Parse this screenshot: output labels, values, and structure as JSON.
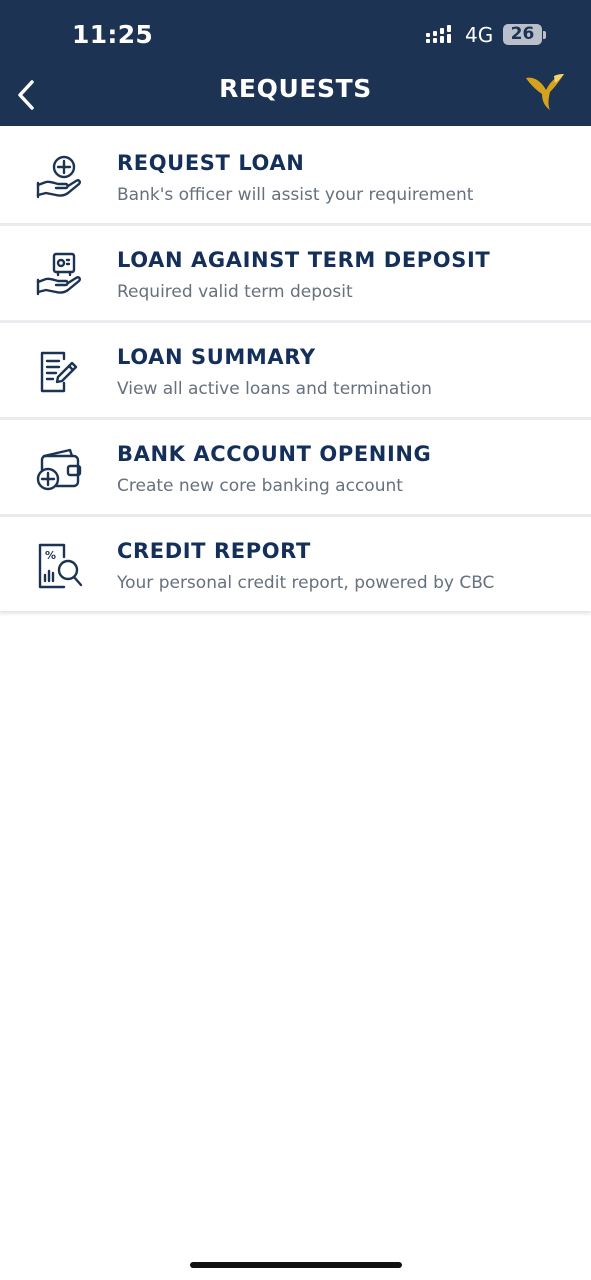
{
  "status_bar": {
    "time": "11:25",
    "network": "4G",
    "battery": "26"
  },
  "header": {
    "title": "REQUESTS",
    "back_icon": "chevron-left-icon",
    "logo_icon": "bird-logo-icon"
  },
  "colors": {
    "header_bg": "#1c3353",
    "title_text": "#14305a",
    "subtitle_text": "#66707e",
    "logo_gold": "#d4a21c"
  },
  "items": [
    {
      "title": "REQUEST LOAN",
      "subtitle": "Bank's officer will assist your requirement",
      "icon": "hand-plus-icon"
    },
    {
      "title": "LOAN AGAINST TERM DEPOSIT",
      "subtitle": "Required valid term deposit",
      "icon": "hand-safe-icon"
    },
    {
      "title": "LOAN SUMMARY",
      "subtitle": "View all active loans and termination",
      "icon": "document-edit-icon"
    },
    {
      "title": "BANK ACCOUNT OPENING",
      "subtitle": "Create new core banking account",
      "icon": "wallet-plus-icon"
    },
    {
      "title": "CREDIT REPORT",
      "subtitle": "Your personal credit report, powered by CBC",
      "icon": "report-search-icon"
    }
  ]
}
